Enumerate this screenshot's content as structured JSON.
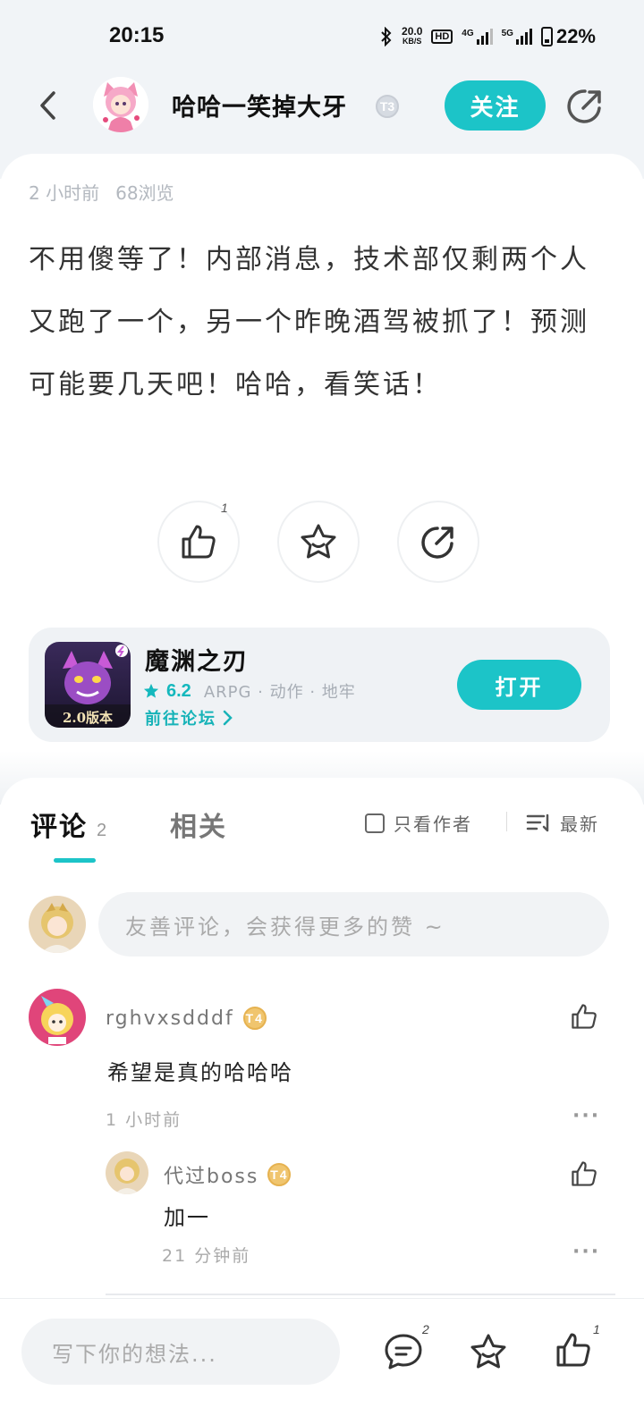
{
  "status_bar": {
    "time": "20:15",
    "net_speed_value": "20.0",
    "net_speed_unit": "KB/S",
    "hd_label": "HD",
    "net1": "4G",
    "net2": "5G",
    "battery": "22%"
  },
  "header": {
    "author_name": "哈哈一笑掉大牙",
    "author_level": "T3",
    "follow_label": "关注"
  },
  "post": {
    "time_ago": "2 小时前",
    "views": "68浏览",
    "body": "不用傻等了！内部消息，技术部仅剩两个人又跑了一个，另一个昨晚酒驾被抓了！预测可能要几天吧！哈哈，看笑话！",
    "like_count": "1"
  },
  "game": {
    "title": "魔渊之刃",
    "score": "6.2",
    "tags": "ARPG · 动作 · 地牢",
    "forum_link": "前往论坛",
    "icon_caption": "2.0版本",
    "open_label": "打开"
  },
  "comments_section": {
    "tab_comment": "评论",
    "tab_comment_count": "2",
    "tab_related": "相关",
    "author_only": "只看作者",
    "sort_label": "最新",
    "input_placeholder": "友善评论，会获得更多的赞 ~"
  },
  "comments": [
    {
      "user": "rghvxsdddf",
      "level": "T4",
      "text": "希望是真的哈哈哈",
      "time": "1 小时前",
      "more": "···"
    },
    {
      "user": "代过boss",
      "level": "T4",
      "text": "加一",
      "time": "21 分钟前",
      "more": "···"
    }
  ],
  "bottom_bar": {
    "write_placeholder": "写下你的想法...",
    "comment_count": "2",
    "like_count": "1"
  },
  "colors": {
    "accent": "#1cc4c8",
    "background_top": "#f1f4f7"
  }
}
